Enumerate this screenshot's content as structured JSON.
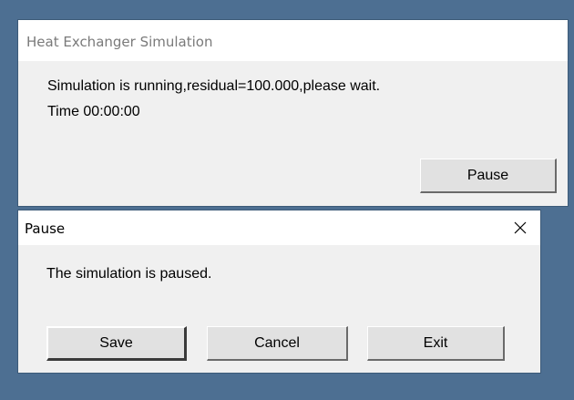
{
  "main_dialog": {
    "title": "Heat Exchanger Simulation",
    "status_text": "Simulation is running,residual=100.000,please wait.",
    "time_text": "Time 00:00:00",
    "pause_label": "Pause"
  },
  "pause_dialog": {
    "title": "Pause",
    "message": "The simulation is paused.",
    "save_label": "Save",
    "cancel_label": "Cancel",
    "exit_label": "Exit",
    "close_icon": "close-icon"
  }
}
